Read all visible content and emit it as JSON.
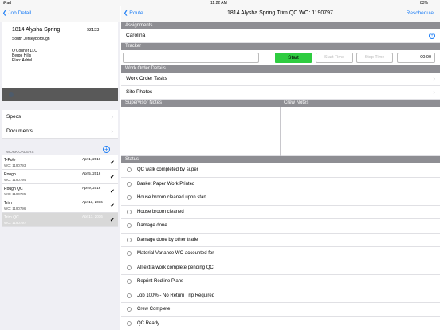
{
  "status_bar": {
    "left": "iPad",
    "time": "11:22 AM",
    "battery": "83%"
  },
  "left_nav": {
    "back_label": "Job Detail"
  },
  "job": {
    "name": "1814 Alysha Spring",
    "number": "92133",
    "subdivision": "South Jerseyborough",
    "builder": "O'Conner LLC",
    "community": "Berge Hills",
    "plan": "Plan: Adriel"
  },
  "menu": [
    {
      "label": "Specs"
    },
    {
      "label": "Documents"
    }
  ],
  "work_orders": {
    "header": "WORK ORDERS",
    "items": [
      {
        "title": "T-Pole",
        "date": "Apr 1, 2016",
        "wo": "WO: 1190793"
      },
      {
        "title": "Rough",
        "date": "Apr 5, 2016",
        "wo": "WO: 1190794"
      },
      {
        "title": "Rough QC",
        "date": "Apr 9, 2016",
        "wo": "WO: 1190795"
      },
      {
        "title": "Trim",
        "date": "Apr 13, 2016",
        "wo": "WO: 1190796"
      },
      {
        "title": "Trim QC",
        "date": "Apr 17, 2016",
        "wo": "WO: 1190797"
      }
    ]
  },
  "right_nav": {
    "back_label": "Route",
    "title": "1814 Alysha Spring Trim QC WO: 1190797",
    "action_label": "Reschedule"
  },
  "assignments": {
    "header": "Assignments",
    "value": "Carolina"
  },
  "tracker": {
    "header": "Tracker",
    "start_label": "Start",
    "start_time_placeholder": "Start Time",
    "stop_time_placeholder": "Stop Time",
    "duration": "00:00"
  },
  "work_order_details": {
    "header": "Work Order Details",
    "items": [
      {
        "label": "Work Order Tasks"
      },
      {
        "label": "Site Photos"
      }
    ]
  },
  "notes": {
    "supervisor_header": "Supervisor Notes",
    "crew_header": "Crew Notes"
  },
  "status": {
    "header": "Status",
    "items": [
      "QC walk completed by super",
      "Basket Paper Work Printed",
      "House broom cleaned upon start",
      "House broom cleaned",
      "Damage done",
      "Damage done by other trade",
      "Material Variance WO accounted for",
      "All extra work complete pending QC",
      "Reprint Redline Plans",
      "Job 100% - No Return Trip Required",
      "Crew Complete",
      "QC Ready"
    ]
  },
  "colors": {
    "accent": "#1a7cf5",
    "start_button": "#2ecc40",
    "section_header": "#8e8e93"
  }
}
